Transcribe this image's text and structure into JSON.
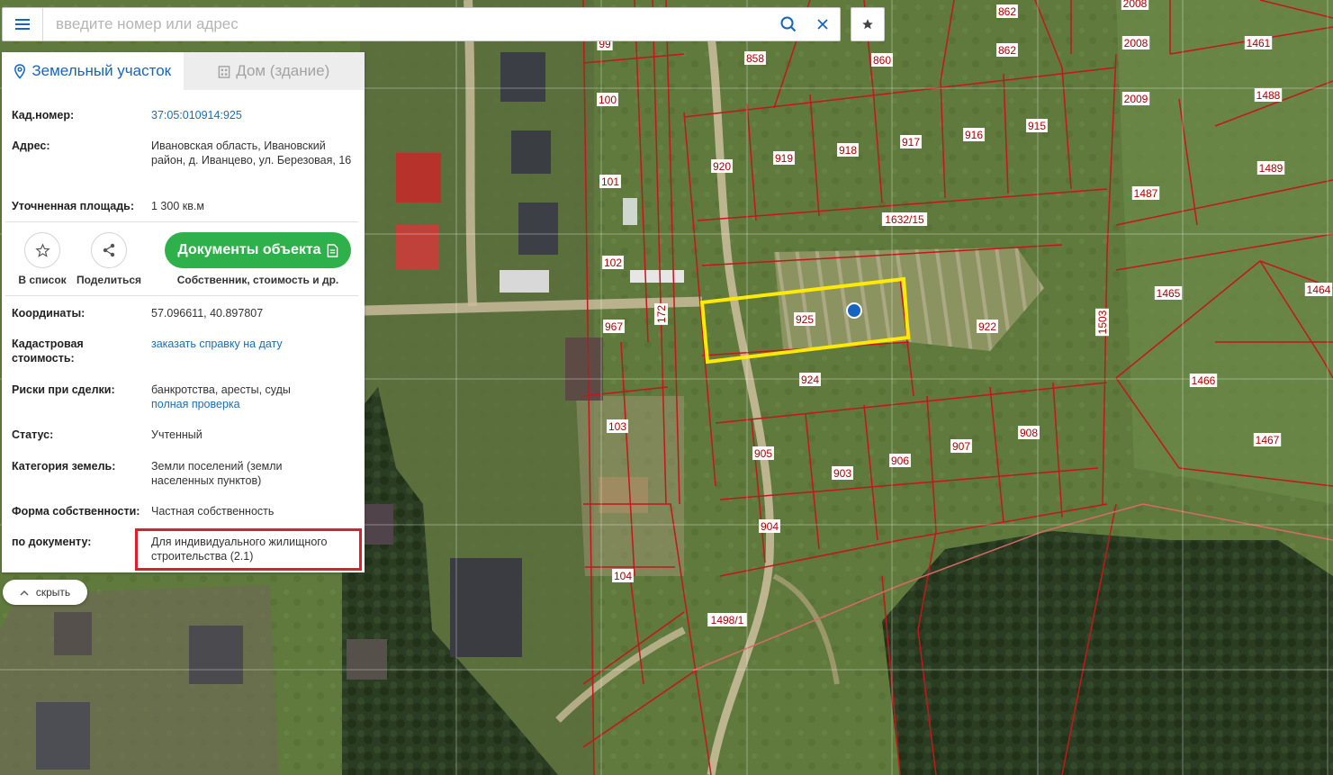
{
  "search": {
    "placeholder": "введите номер или адрес"
  },
  "icons": {
    "menu": "menu-icon",
    "search": "search-icon",
    "clear": "close-icon",
    "favorites": "star-icon",
    "land": "location-pin-icon",
    "building": "building-icon",
    "add_to_list": "star-outline-icon",
    "share": "share-icon",
    "docs": "document-icon",
    "hide": "chevron-up-icon"
  },
  "colors": {
    "accent": "#1565c0",
    "docs_button": "#2eb14b",
    "highlight": "#e01e2b",
    "selected_plot": "#ffea00",
    "boundaries": "#c4161c"
  },
  "tabs": [
    {
      "label": "Земельный участок",
      "active": true
    },
    {
      "label": "Дом (здание)",
      "active": false
    }
  ],
  "info_top": [
    {
      "key": "Кад.номер:",
      "value": "37:05:010914:925",
      "link": true
    },
    {
      "key": "Адрес:",
      "value": "Ивановская область, Ивановский район, д. Иванцево, ул. Березовая, 16"
    },
    {
      "key": "Уточненная площадь:",
      "value": "1 300 кв.м"
    }
  ],
  "actions": {
    "add_to_list": "В список",
    "share": "Поделиться",
    "documents": "Документы объекта",
    "documents_sub": "Собственник, стоимость и др."
  },
  "info_bottom": [
    {
      "key": "Координаты:",
      "value": "57.096611, 40.897807"
    },
    {
      "key": "Кадастровая стоимость:",
      "value": "заказать справку на дату",
      "link": true
    },
    {
      "key": "Риски при сделки:",
      "value": "банкротства, аресты, суды",
      "value2": "полная проверка"
    },
    {
      "key": "Статус:",
      "value": "Учтенный"
    },
    {
      "key": "Категория земель:",
      "value": "Земли поселений (земли населенных пунктов)"
    },
    {
      "key": "Форма собственности:",
      "value": "Частная собственность"
    },
    {
      "key": "по документу:",
      "value": "Для индивидуального жилищного строительства (2.1)"
    }
  ],
  "hide_label": "скрыть",
  "map": {
    "plot_labels": [
      "99",
      "858",
      "860",
      "862",
      "862",
      "2008",
      "2008",
      "1461",
      "100",
      "918",
      "917",
      "916",
      "915",
      "2009",
      "1488",
      "920",
      "919",
      "101",
      "1489",
      "1487",
      "1632/15",
      "102",
      "925",
      "922",
      "1465",
      "1464",
      "967",
      "172",
      "924",
      "1503",
      "1466",
      "103",
      "905",
      "906",
      "907",
      "908",
      "1467",
      "903",
      "904",
      "104",
      "1498/1"
    ]
  }
}
